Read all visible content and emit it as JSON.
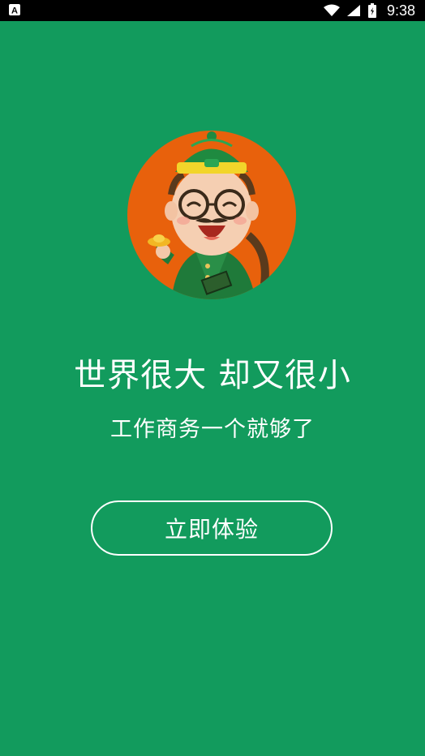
{
  "status_bar": {
    "notification_icon": "a-icon",
    "wifi_icon": "wifi-icon",
    "signal_icon": "signal-icon",
    "battery_icon": "battery-icon",
    "time": "9:38"
  },
  "avatar": {
    "icon": "cartoon-merchant-avatar",
    "bg_color": "#e8610c"
  },
  "headline": "世界很大 却又很小",
  "subline": "工作商务一个就够了",
  "cta": {
    "label": "立即体验"
  },
  "colors": {
    "background": "#129b5d",
    "text": "#ffffff"
  }
}
